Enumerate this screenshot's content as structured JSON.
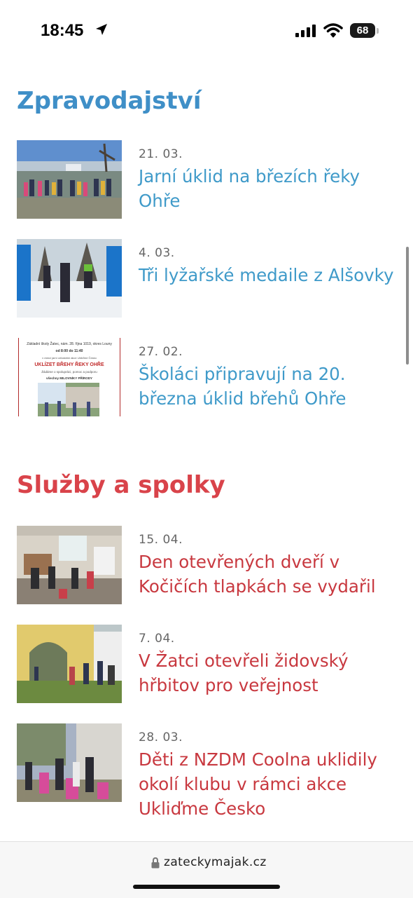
{
  "status_bar": {
    "time": "18:45",
    "battery": "68",
    "icons": [
      "location-arrow-icon",
      "signal-icon",
      "wifi-icon",
      "battery-icon"
    ]
  },
  "news": {
    "title": "Zpravodajství",
    "accent_color": "#3f8fc7",
    "articles": [
      {
        "date": "21. 03.",
        "title": "Jarní úklid na březích řeky Ohře"
      },
      {
        "date": "4. 03.",
        "title": "Tři lyžařské medaile z Alšovky"
      },
      {
        "date": "27. 02.",
        "title": "Školáci připravují na 20. března úklid břehů Ohře"
      }
    ],
    "poster": {
      "line1": "Základní školy Žatec, nám. 28. října 1019, okres Louny",
      "line2": "od 8:00 do 11:40",
      "line3": "v rámci jarní celostátní akce Ukliďme Česko",
      "line4": "UKLÍZET BŘEHY ŘEKY OHŘE",
      "line5": "Žádáme o spolupráci, pomoc a podporu",
      "line6": "všechny MILOVNÍKY PŘÍRODY"
    }
  },
  "services": {
    "title": "Služby a spolky",
    "accent_color": "#d9434a",
    "articles": [
      {
        "date": "15. 04.",
        "title": "Den otevřených dveří v Kočičích tlapkách se vydařil"
      },
      {
        "date": "7. 04.",
        "title": "V Žatci otevřeli židovský hřbitov pro veřejnost"
      },
      {
        "date": "28. 03.",
        "title": "Děti z NZDM Coolna uklidily okolí klubu v rámci akce Ukliďme Česko"
      }
    ]
  },
  "browser": {
    "url": "zateckymajak.cz"
  }
}
